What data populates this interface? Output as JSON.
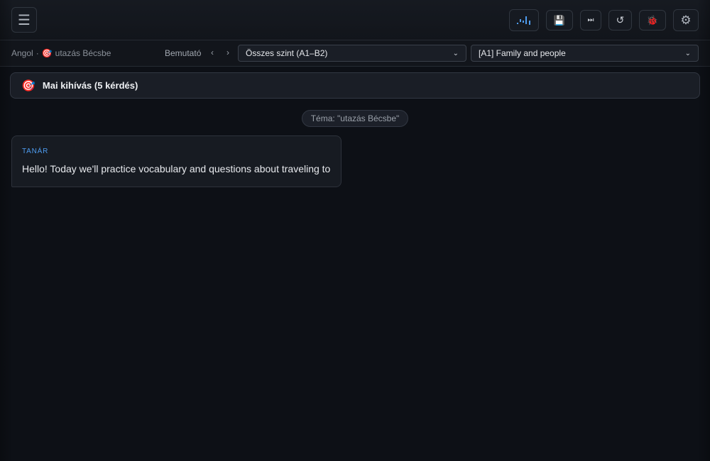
{
  "header": {
    "menu_icon": "hamburger-menu-icon",
    "buttons": {
      "audio": "audio-wave-icon",
      "save": "floppy-disk-icon",
      "skip": "skip-forward-icon",
      "reset": "reset-icon",
      "bug": "bug-icon",
      "settings": "gear-icon"
    },
    "accent": "#4e9cf0"
  },
  "subbar": {
    "crumb_lang": "Angol",
    "crumb_sep": "·",
    "crumb_topic": "utazás Bécsbe",
    "demo_label": "Bemutató",
    "prev": "‹",
    "next": "›",
    "level_select": "Összes szint (A1–B2)",
    "topic_select": "[A1] Family and people"
  },
  "challenge": {
    "label": "Mai kihívás (5 kérdés)"
  },
  "chat": {
    "topic_pill": "Téma: \"utazás Bécsbe\"",
    "messages": [
      {
        "role": "TANÁR",
        "text": "Hello! Today we'll practice vocabulary and questions about traveling to"
      }
    ]
  }
}
